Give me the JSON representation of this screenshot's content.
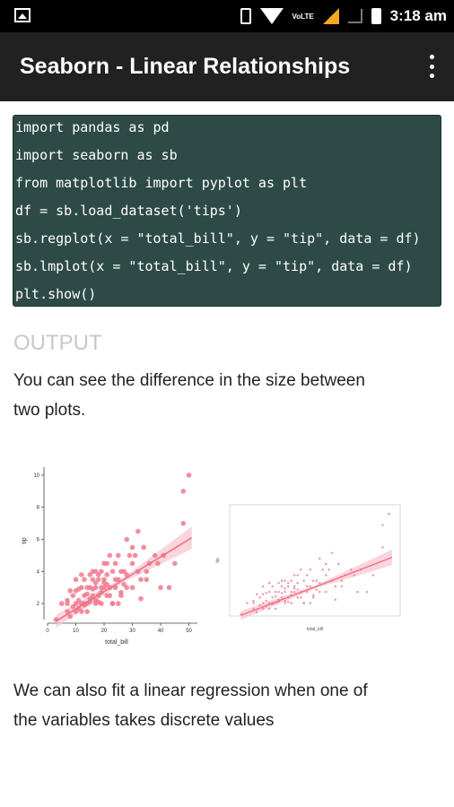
{
  "status_bar": {
    "time": "3:18 am",
    "network": "VoLTE",
    "icons": [
      "image-icon",
      "vibrate-icon",
      "wifi-icon",
      "signal-icon",
      "signal-empty-icon",
      "battery-icon"
    ],
    "signal_color": "#f5a623"
  },
  "app_bar": {
    "title": "Seaborn - Linear Relationships",
    "background": "#212121",
    "menu_icon": "more-vert-icon"
  },
  "code_block": {
    "background": "#2e4a47",
    "lines": [
      "import pandas as pd",
      "import seaborn as sb",
      "from matplotlib import pyplot as plt",
      "df = sb.load_dataset('tips')",
      "sb.regplot(x = \"total_bill\", y = \"tip\", data = df)",
      "sb.lmplot(x = \"total_bill\", y = \"tip\", data = df)",
      "plt.show()"
    ]
  },
  "content": {
    "output_heading": "OUTPUT",
    "paragraph_1": "You can see the difference in the size between two plots.",
    "paragraph_1_lines": [
      "You can see the difference in the size between",
      "two plots."
    ],
    "paragraph_2_lines": [
      "We can also fit a linear regression when one of",
      "the variables takes discrete values"
    ]
  },
  "chart_data": [
    {
      "type": "scatter",
      "xlabel": "total_bill",
      "ylabel": "tip",
      "xticks": [
        "0",
        "10",
        "20",
        "30",
        "40",
        "50"
      ],
      "yticks": [
        "2",
        "4",
        "6",
        "8",
        "10"
      ],
      "xlim": [
        0,
        53
      ],
      "ylim": [
        1,
        10.5
      ],
      "regression": {
        "x": [
          3,
          51
        ],
        "y": [
          0.9,
          6.1
        ]
      },
      "point_color": "#f07a8e",
      "x": [
        3,
        5,
        7,
        7,
        8,
        9,
        9,
        10,
        10,
        10,
        11,
        11,
        12,
        12,
        12,
        13,
        13,
        13,
        14,
        14,
        14,
        15,
        15,
        15,
        16,
        16,
        16,
        17,
        17,
        17,
        17,
        18,
        18,
        18,
        19,
        19,
        19,
        20,
        20,
        20,
        21,
        21,
        21,
        22,
        22,
        23,
        23,
        24,
        24,
        25,
        25,
        26,
        26,
        27,
        28,
        28,
        29,
        30,
        30,
        31,
        32,
        32,
        33,
        34,
        35,
        35,
        36,
        38,
        39,
        40,
        41,
        43,
        45,
        48,
        48,
        50,
        7,
        8,
        10,
        11,
        12,
        13,
        14,
        15,
        16,
        17,
        18,
        19,
        20,
        21,
        22,
        23,
        24,
        25,
        26,
        27,
        28,
        30,
        33
      ],
      "y": [
        1.0,
        2.0,
        1.5,
        2.0,
        1.2,
        1.8,
        2.5,
        1.5,
        2.0,
        2.8,
        1.7,
        2.2,
        2.0,
        3.0,
        1.5,
        2.5,
        2.0,
        3.5,
        2.0,
        3.0,
        1.5,
        2.3,
        3.0,
        3.8,
        2.5,
        3.5,
        4.0,
        2.0,
        3.0,
        3.3,
        4.0,
        2.5,
        3.5,
        3.8,
        2.0,
        3.0,
        4.0,
        3.0,
        3.5,
        4.5,
        2.5,
        3.2,
        4.5,
        3.0,
        5.0,
        2.0,
        4.0,
        3.0,
        4.5,
        3.5,
        5.0,
        2.5,
        4.0,
        4.0,
        3.0,
        6.0,
        5.0,
        3.0,
        4.5,
        5.0,
        4.0,
        6.5,
        3.5,
        5.5,
        4.0,
        3.5,
        4.5,
        5.0,
        4.5,
        3.0,
        5.0,
        3.0,
        4.5,
        9.0,
        7.0,
        10.0,
        2.2,
        2.8,
        3.5,
        2.9,
        3.8,
        1.9,
        2.6,
        2.1,
        2.9,
        2.2,
        2.1,
        2.7,
        3.3,
        3.8,
        2.5,
        2.0,
        3.5,
        2.0,
        2.7,
        3.2,
        3.8,
        5.5,
        2.3
      ]
    },
    {
      "type": "scatter",
      "xlabel": "total_bill",
      "ylabel": "tip",
      "xlim": [
        0,
        53
      ],
      "ylim": [
        1,
        10.5
      ],
      "regression": {
        "x": [
          3,
          51
        ],
        "y": [
          0.9,
          6.1
        ]
      },
      "point_color": "#f07a8e",
      "x": [
        3,
        5,
        7,
        7,
        8,
        9,
        9,
        10,
        10,
        10,
        11,
        11,
        12,
        12,
        12,
        13,
        13,
        13,
        14,
        14,
        14,
        15,
        15,
        15,
        16,
        16,
        16,
        17,
        17,
        17,
        17,
        18,
        18,
        18,
        19,
        19,
        19,
        20,
        20,
        20,
        21,
        21,
        21,
        22,
        22,
        23,
        23,
        24,
        24,
        25,
        25,
        26,
        26,
        27,
        28,
        28,
        29,
        30,
        30,
        31,
        32,
        32,
        33,
        34,
        35,
        35,
        36,
        38,
        39,
        40,
        41,
        43,
        45,
        48,
        48,
        50,
        7,
        8,
        10,
        11,
        12,
        13,
        14,
        15,
        16,
        17,
        18,
        19,
        20,
        21,
        22,
        23,
        24,
        25,
        26,
        27,
        28,
        30,
        33
      ],
      "y": [
        1.0,
        2.0,
        1.5,
        2.0,
        1.2,
        1.8,
        2.5,
        1.5,
        2.0,
        2.8,
        1.7,
        2.2,
        2.0,
        3.0,
        1.5,
        2.5,
        2.0,
        3.5,
        2.0,
        3.0,
        1.5,
        2.3,
        3.0,
        3.8,
        2.5,
        3.5,
        4.0,
        2.0,
        3.0,
        3.3,
        4.0,
        2.5,
        3.5,
        3.8,
        2.0,
        3.0,
        4.0,
        3.0,
        3.5,
        4.5,
        2.5,
        3.2,
        4.5,
        3.0,
        5.0,
        2.0,
        4.0,
        3.0,
        4.5,
        3.5,
        5.0,
        2.5,
        4.0,
        4.0,
        3.0,
        6.0,
        5.0,
        3.0,
        4.5,
        5.0,
        4.0,
        6.5,
        3.5,
        5.5,
        4.0,
        3.5,
        4.5,
        5.0,
        4.5,
        3.0,
        5.0,
        3.0,
        4.5,
        9.0,
        7.0,
        10.0,
        2.2,
        2.8,
        3.5,
        2.9,
        3.8,
        1.9,
        2.6,
        2.1,
        2.9,
        2.2,
        2.1,
        2.7,
        3.3,
        3.8,
        2.5,
        2.0,
        3.5,
        2.0,
        2.7,
        3.2,
        3.8,
        5.5,
        2.3
      ]
    }
  ]
}
